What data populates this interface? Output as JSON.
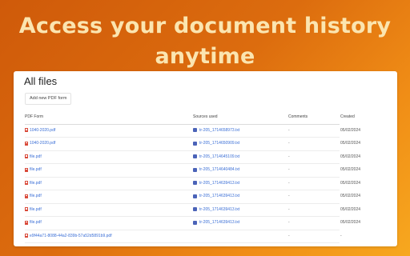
{
  "headline": {
    "line1": "Access your document history",
    "line2": "anytime"
  },
  "panel": {
    "title": "All files",
    "add_button": "Add new PDF form",
    "columns": {
      "pdf_form": "PDF Form",
      "sources": "Sources used",
      "comments": "Comments",
      "created": "Created"
    }
  },
  "rows": [
    {
      "file": "1040-2020.pdf",
      "source": "tr-205_1714658973.txt",
      "comments": "-",
      "created": "05/02/2024"
    },
    {
      "file": "1040-2020.pdf",
      "source": "tr-205_1714650909.txt",
      "comments": "-",
      "created": "05/02/2024"
    },
    {
      "file": "file.pdf",
      "source": "tr-205_1714645109.txt",
      "comments": "-",
      "created": "05/02/2024"
    },
    {
      "file": "file.pdf",
      "source": "tr-205_1714640484.txt",
      "comments": "-",
      "created": "05/02/2024"
    },
    {
      "file": "file.pdf",
      "source": "tr-205_1714639413.txt",
      "comments": "-",
      "created": "05/02/2024"
    },
    {
      "file": "file.pdf",
      "source": "tr-205_1714639413.txt",
      "comments": "-",
      "created": "05/02/2024"
    },
    {
      "file": "file.pdf",
      "source": "tr-205_1714639413.txt",
      "comments": "-",
      "created": "05/02/2024"
    },
    {
      "file": "file.pdf",
      "source": "tr-205_1714639413.txt",
      "comments": "-",
      "created": "05/02/2024"
    },
    {
      "file": "e9f44a71-8088-44a2-839b-57a52d5891b9.pdf",
      "source": "",
      "comments": "-",
      "created": "-"
    }
  ],
  "colors": {
    "headline": "#fbe5b0",
    "link": "#3b6fd6",
    "pdf_icon": "#d94a3a",
    "txt_icon": "#4b63b8"
  }
}
